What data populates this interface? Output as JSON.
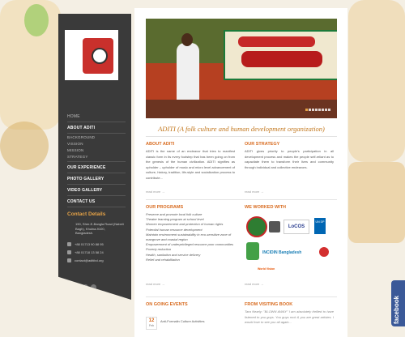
{
  "nav": {
    "items": [
      {
        "label": "HOME",
        "type": "home"
      },
      {
        "label": "ABOUT ADITI",
        "type": "bold"
      },
      {
        "label": "BACKGROUND",
        "type": "sub"
      },
      {
        "label": "VISSION",
        "type": "sub"
      },
      {
        "label": "MISSION",
        "type": "sub"
      },
      {
        "label": "STRATEGY",
        "type": "sub"
      },
      {
        "label": "OUR EXPERIENCE",
        "type": "bold"
      },
      {
        "label": "PHOTO GALLERY",
        "type": "bold"
      },
      {
        "label": "VIDEO GALLERY",
        "type": "bold"
      },
      {
        "label": "CONTACT US",
        "type": "bold"
      }
    ]
  },
  "contact": {
    "title": "Contact Details",
    "address": "190, Sher-E-Bangla Road (Nabeli Bagh), Khulna-9100, Bangladesh.",
    "phone1": "+88 01713 90 88 95",
    "phone2": "+88 01718 13 58 24",
    "email": "contact@aditibd.org"
  },
  "main": {
    "tagline": "ADITI (A folk culture and human development organization)",
    "about": {
      "title": "ABOUT ADITI",
      "text": "ADITI is the name of an endeavor that tries to manifest classic form in its every footstep that has been going on from the genesis of the human civilization. ADITI signifies as upholder – upholder of music and micro level advancement of culture, history, tradition, life-style and socialization process to contribute...",
      "more": "read more →"
    },
    "strategy": {
      "title": "OUR STRATEGY",
      "text": "ADITI gives priority to people's participation in all development process and makes the people self-reliant as to capacitate them to transform their lives and community through individual and collective endeavors.",
      "more": "read more →"
    },
    "programs": {
      "title": "OUR PROGRAMS",
      "items": [
        "Preserve and promote local folk culture",
        "Theater learning program at school level",
        "Women empowerment and protection of human rights",
        "Potential human resource development",
        "Maintain environment sustainability in eco-sensitive zone of mangrove and coastal region",
        "Empowerment of underprivileged resource poor communities",
        "Poverty reduction",
        "Health, sanitation and service delivery",
        "Relief and rehabilitation"
      ],
      "more": "read more →"
    },
    "worked": {
      "title": "WE WORKED WITH",
      "logos": [
        "LoCOS",
        "UN DP",
        "INCIDIN Bangladesh",
        "World Vision"
      ],
      "more": "read more →"
    },
    "events": {
      "title": "ON GOING EVENTS",
      "date_day": "12",
      "date_month": "Feb",
      "item": "Anti-Formalin Culture Activities"
    },
    "visitors": {
      "title": "FROM VISITING BOOK",
      "text": "Tara Nearly: \"BLOWN AWAY\" I am absolutely thrilled to have listened to you guys. You guys rock & you are great artistes. I would love to see you all again..."
    }
  },
  "facebook_label": "facebook",
  "colors": {
    "accent": "#d86b1f",
    "sidebar": "#3a3a3a",
    "facebook": "#3b5998"
  }
}
